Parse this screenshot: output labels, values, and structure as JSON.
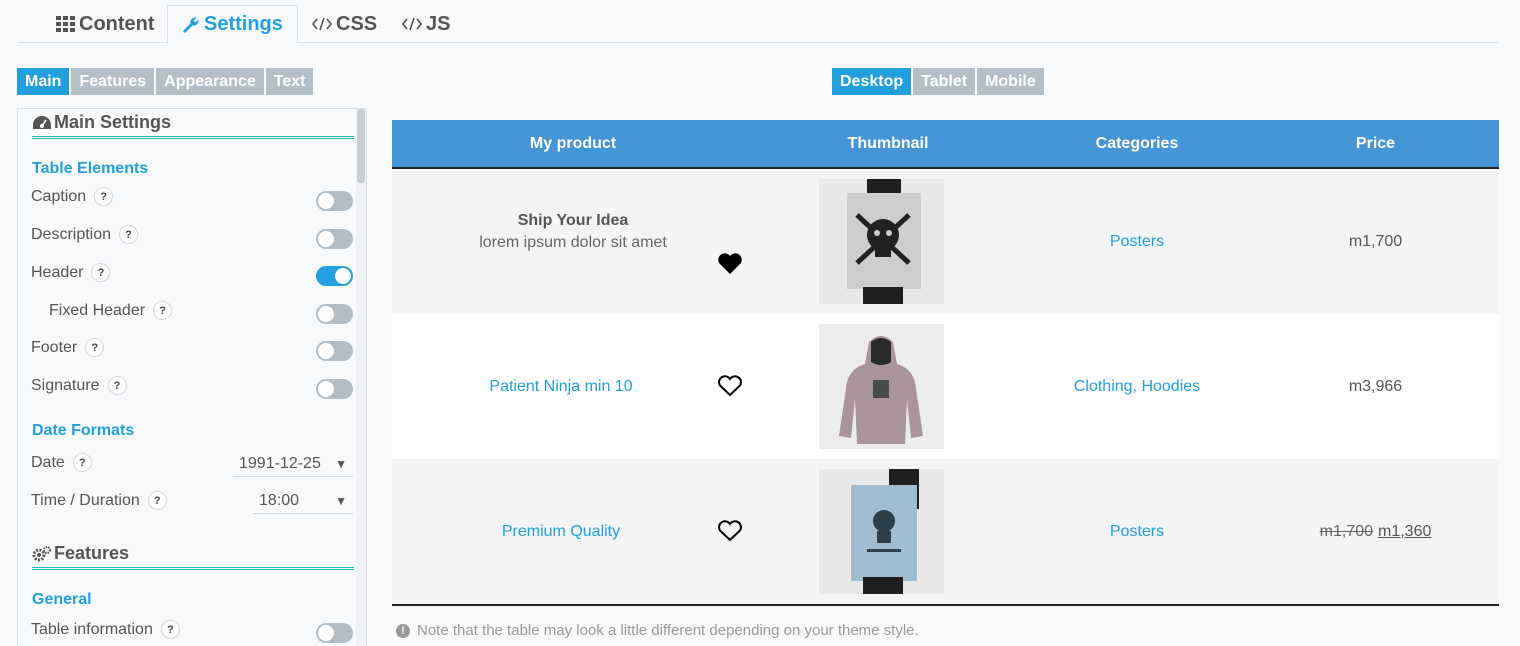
{
  "top_tabs": [
    {
      "label": "Content",
      "icon": "grid-icon"
    },
    {
      "label": "Settings",
      "icon": "wrench-icon"
    },
    {
      "label": "CSS",
      "icon": "code-icon"
    },
    {
      "label": "JS",
      "icon": "code-icon"
    }
  ],
  "left_subtabs": [
    "Main",
    "Features",
    "Appearance",
    "Text"
  ],
  "device_tabs": [
    "Desktop",
    "Tablet",
    "Mobile"
  ],
  "panel": {
    "main_settings_title": "Main Settings",
    "table_elements_title": "Table Elements",
    "elements": [
      {
        "label": "Caption",
        "on": false
      },
      {
        "label": "Description",
        "on": false
      },
      {
        "label": "Header",
        "on": true
      },
      {
        "label": "Fixed Header",
        "on": false
      },
      {
        "label": "Footer",
        "on": false
      },
      {
        "label": "Signature",
        "on": false
      }
    ],
    "date_formats_title": "Date Formats",
    "date_label": "Date",
    "date_value": "1991-12-25",
    "time_label": "Time / Duration",
    "time_value": "18:00",
    "features_title": "Features",
    "general_title": "General",
    "table_info_label": "Table information",
    "help_glyph": "?"
  },
  "table": {
    "headers": [
      "My product",
      "Thumbnail",
      "Categories",
      "Price"
    ],
    "rows": [
      {
        "title": "Ship Your Idea",
        "subtitle": "lorem ipsum dolor sit amet",
        "favorite": true,
        "category": "Posters",
        "price": "m1,700",
        "old_price": ""
      },
      {
        "title": "Patient Ninja min 10",
        "subtitle": "",
        "favorite": false,
        "category": "Clothing, Hoodies",
        "price": "m3,966",
        "old_price": ""
      },
      {
        "title": "Premium Quality",
        "subtitle": "",
        "favorite": false,
        "category": "Posters",
        "price": "m1,360",
        "old_price": "m1,700"
      }
    ]
  },
  "note": "Note that the table may look a little different depending on your theme style.",
  "colors": {
    "accent": "#21a0dd",
    "header_bg": "#4695d6",
    "toggle_off": "#b4bdc4",
    "section_rule": "#23b7b0"
  }
}
